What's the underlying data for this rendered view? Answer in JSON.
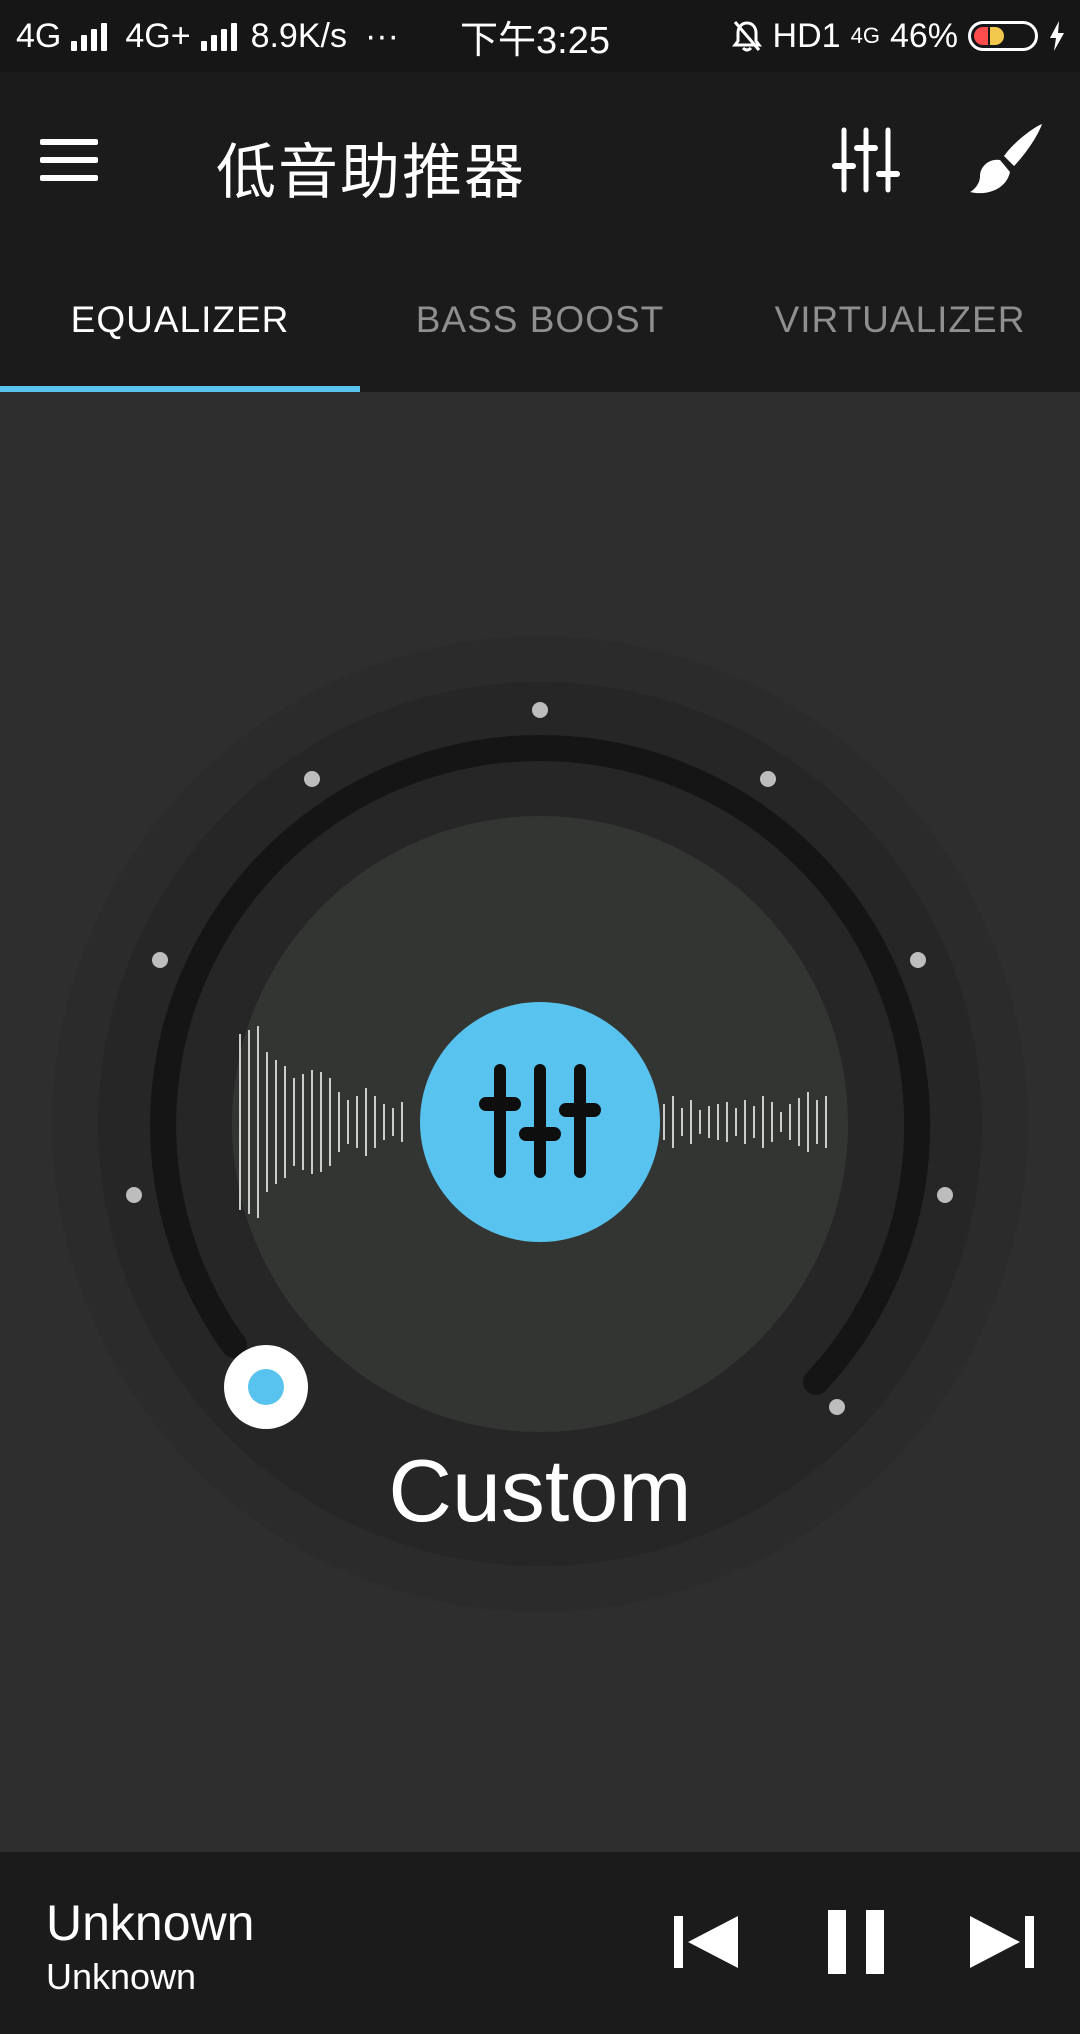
{
  "status_bar": {
    "network1": "4G",
    "network2": "4G+",
    "speed": "8.9K/s",
    "more": "···",
    "time": "下午3:25",
    "hd": "HD1",
    "lte": "4G",
    "battery_pct": "46%"
  },
  "app_bar": {
    "title": "低音助推器"
  },
  "tabs": [
    {
      "label": "EQUALIZER",
      "active": true
    },
    {
      "label": "BASS BOOST",
      "active": false
    },
    {
      "label": "VIRTUALIZER",
      "active": false
    }
  ],
  "equalizer": {
    "preset": "Custom",
    "knob_level": 0.0,
    "accent_color": "#58c3ee"
  },
  "player": {
    "title": "Unknown",
    "artist": "Unknown"
  }
}
